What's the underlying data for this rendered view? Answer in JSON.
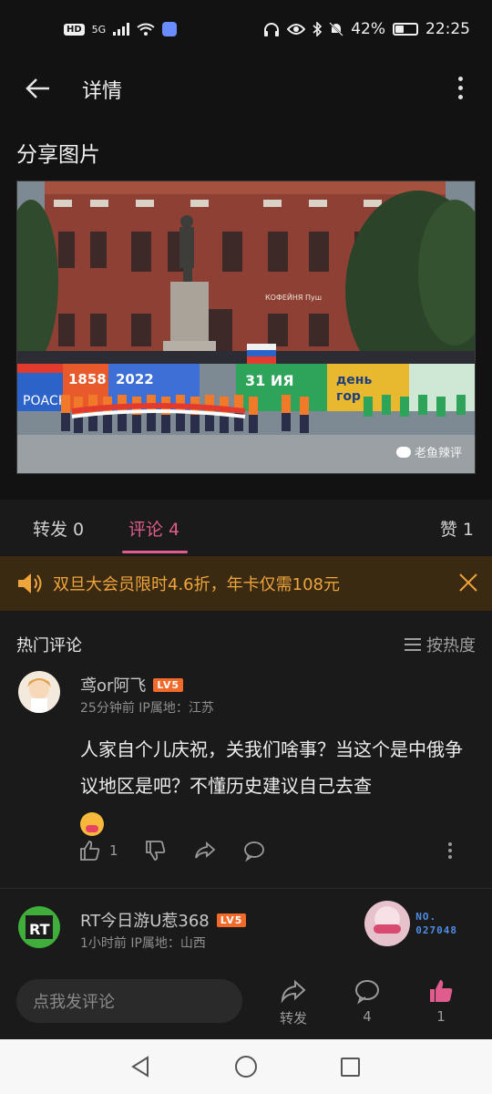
{
  "status_bar": {
    "hd": "HD",
    "network": "5G",
    "battery": "42%",
    "battery_level": 0.42,
    "time": "22:25"
  },
  "header": {
    "title": "详情"
  },
  "post": {
    "title": "分享图片",
    "image_texts": {
      "year_start": "1858",
      "year_end": "2022",
      "banner_left": "РОАСК",
      "banner_day": "31 ИЯ",
      "banner_right": "день",
      "banner_right2": "гор",
      "building_sign": "КОФЕЙНЯ Пуш"
    },
    "watermark": "老鱼辣评"
  },
  "tabs": {
    "repost": "转发 0",
    "comment": "评论 4",
    "like": "赞 1"
  },
  "promo": {
    "text": "双旦大会员限时4.6折，年卡仅需108元"
  },
  "comments_section": {
    "title": "热门评论",
    "sort_label": "按热度",
    "comments": [
      {
        "user": "鸢or阿飞",
        "level": "LV5",
        "meta": "25分钟前  IP属地：江苏",
        "text": "人家自个儿庆祝，关我们啥事？当这个是中俄争议地区是吧？不懂历史建议自己去查",
        "like_count": "1"
      },
      {
        "user": "RT今日游U惹368",
        "level": "LV5",
        "meta": "1小时前  IP属地：山西",
        "medal_label": "NO.",
        "medal_number": "027048"
      }
    ]
  },
  "bottom_bar": {
    "input_placeholder": "点我发评论",
    "repost_label": "转发",
    "comment_count": "4",
    "like_count": "1"
  },
  "colors": {
    "accent": "#e05c8c",
    "promo_text": "#f0a53c",
    "level_badge": "#f26a2a"
  }
}
